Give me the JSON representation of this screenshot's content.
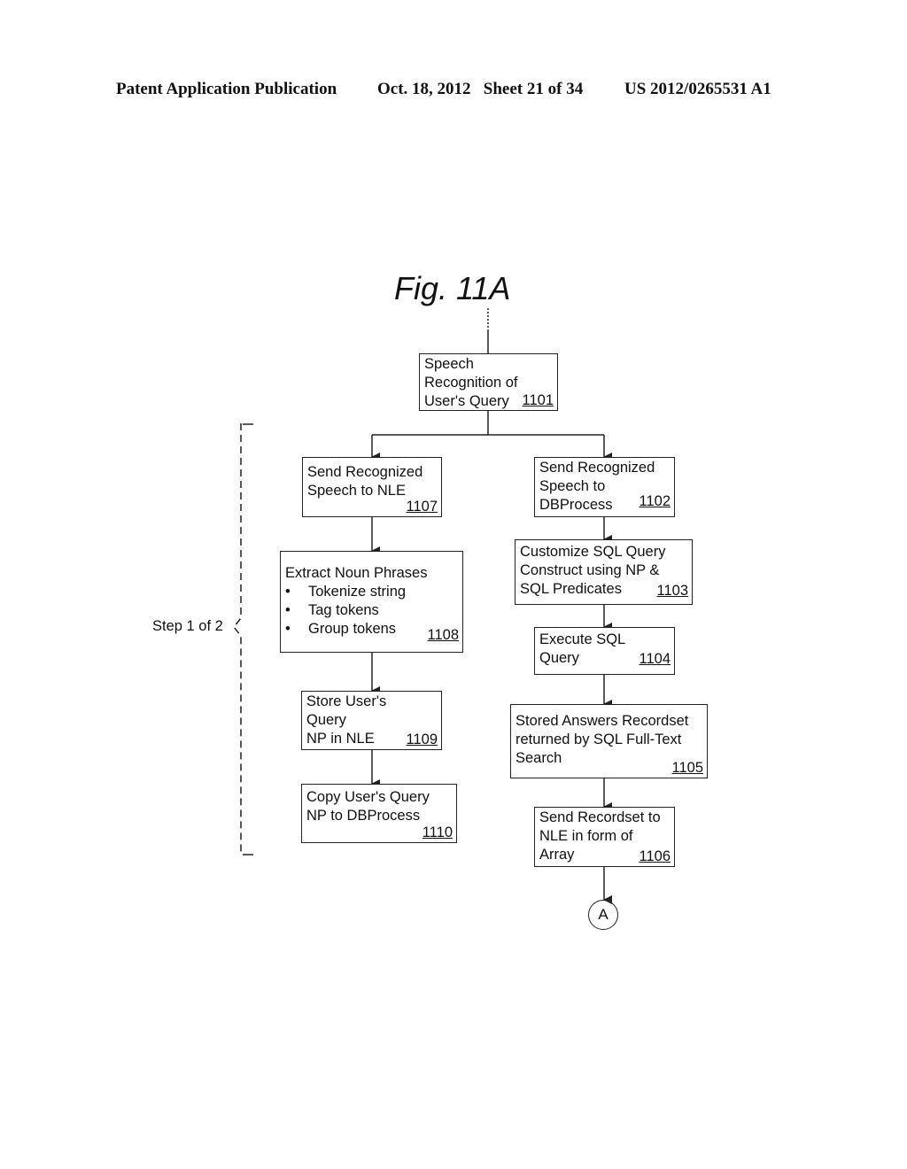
{
  "header": {
    "publication": "Patent Application Publication",
    "date_sheet": "Oct. 18, 2012   Sheet 21 of 34",
    "patent_number": "US 2012/0265531 A1"
  },
  "figure": {
    "title": "Fig. 11A",
    "step_label": "Step 1 of 2",
    "connector_label": "A",
    "nodes": {
      "n1101": {
        "lines": [
          "Speech",
          "Recognition of",
          "User's Query"
        ],
        "ref": "1101"
      },
      "n1107": {
        "lines": [
          "Send Recognized",
          "Speech to NLE"
        ],
        "ref": "1107"
      },
      "n1108": {
        "lines": [
          "Extract Noun Phrases"
        ],
        "bullets": [
          "Tokenize string",
          "Tag tokens",
          "Group tokens"
        ],
        "ref": "1108"
      },
      "n1109": {
        "lines": [
          "Store User's",
          "Query",
          "NP in NLE"
        ],
        "ref": "1109"
      },
      "n1110": {
        "lines": [
          "Copy User's Query",
          "NP to DBProcess"
        ],
        "ref": "1110"
      },
      "n1102": {
        "lines": [
          "Send Recognized",
          "Speech to",
          "DBProcess"
        ],
        "ref": "1102"
      },
      "n1103": {
        "lines": [
          "Customize SQL Query",
          "Construct using NP &",
          "SQL Predicates"
        ],
        "ref": "1103"
      },
      "n1104": {
        "lines": [
          "Execute SQL",
          "Query"
        ],
        "ref": "1104"
      },
      "n1105": {
        "lines": [
          "Stored Answers Recordset",
          "returned by SQL Full-Text",
          "Search"
        ],
        "ref": "1105"
      },
      "n1106": {
        "lines": [
          "Send Recordset to",
          "NLE in form of",
          "Array"
        ],
        "ref": "1106"
      }
    },
    "edges": [
      [
        "n1101",
        "n1107"
      ],
      [
        "n1101",
        "n1102"
      ],
      [
        "n1107",
        "n1108"
      ],
      [
        "n1108",
        "n1109"
      ],
      [
        "n1109",
        "n1110"
      ],
      [
        "n1102",
        "n1103"
      ],
      [
        "n1103",
        "n1104"
      ],
      [
        "n1104",
        "n1105"
      ],
      [
        "n1105",
        "n1106"
      ],
      [
        "n1106",
        "connector-A"
      ]
    ]
  }
}
